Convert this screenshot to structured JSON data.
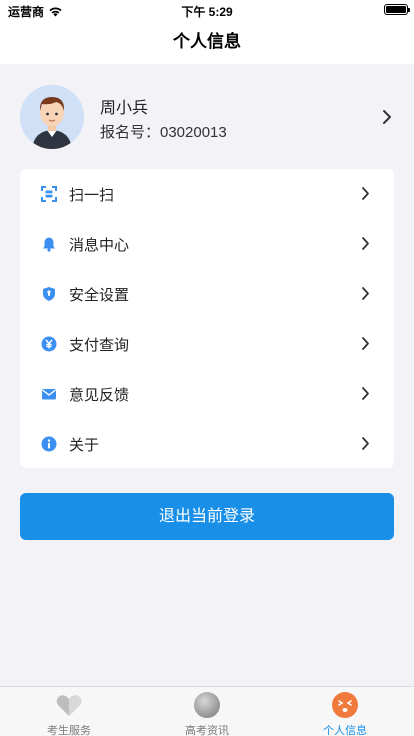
{
  "status_bar": {
    "carrier": "运营商",
    "time": "下午 5:29"
  },
  "nav": {
    "title": "个人信息"
  },
  "profile": {
    "name": "周小兵",
    "registration_label": "报名号：03020013"
  },
  "menu": {
    "items": [
      {
        "label": "扫一扫",
        "icon": "scan-icon"
      },
      {
        "label": "消息中心",
        "icon": "bell-icon"
      },
      {
        "label": "安全设置",
        "icon": "shield-icon"
      },
      {
        "label": "支付查询",
        "icon": "yuan-icon"
      },
      {
        "label": "意见反馈",
        "icon": "mail-icon"
      },
      {
        "label": "关于",
        "icon": "info-icon"
      }
    ]
  },
  "logout": {
    "label": "退出当前登录"
  },
  "tabs": [
    {
      "label": "考生服务",
      "icon": "heart-icon",
      "active": false
    },
    {
      "label": "高考资讯",
      "icon": "ball-icon",
      "active": false
    },
    {
      "label": "个人信息",
      "icon": "face-icon",
      "active": true
    }
  ],
  "colors": {
    "accent": "#1a8fe8",
    "page_background": "#f2f2f7",
    "icon_blue": "#3b8ff0",
    "tab_inactive": "#7a7a7a",
    "active_tab_icon": "#f07a3c"
  }
}
